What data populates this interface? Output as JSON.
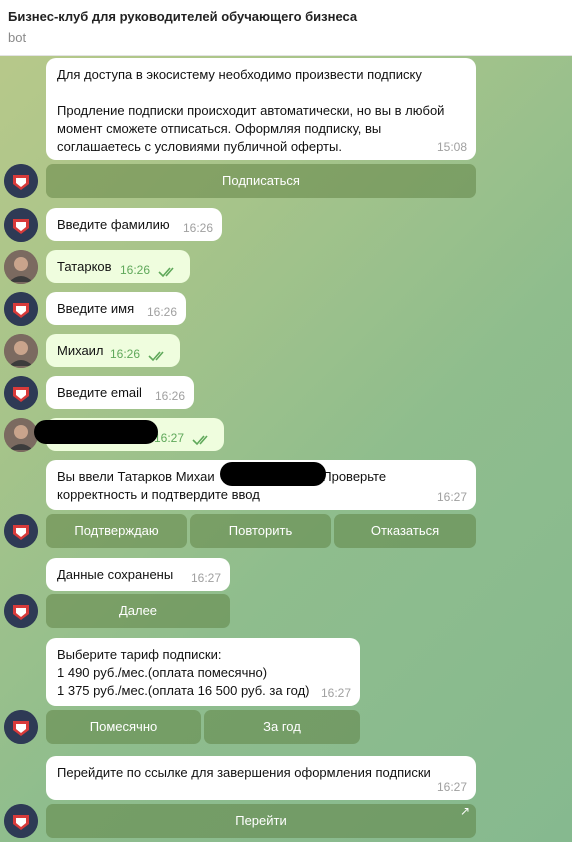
{
  "header": {
    "title": "Бизнес-клуб для руководителей обучающего бизнеса",
    "subtitle": "bot"
  },
  "messages": {
    "m1": {
      "text": "Для доступа в экосистему необходимо произвести подписку\n\nПродление подписки происходит автоматически, но вы в любой момент сможете отписаться. Оформляя подписку, вы соглашаетесь с условиями публичной оферты.",
      "time": "15:08"
    },
    "m2": {
      "text": "Введите фамилию",
      "time": "16:26"
    },
    "m3": {
      "text": "Татарков",
      "time": "16:26"
    },
    "m4": {
      "text": "Введите имя",
      "time": "16:26"
    },
    "m5": {
      "text": "Михаил",
      "time": "16:26"
    },
    "m6": {
      "text": "Введите email",
      "time": "16:26"
    },
    "m7": {
      "text": "",
      "time": "16:27"
    },
    "m8": {
      "line1a": "Вы ввели Татарков Михаи",
      "line1b": " Проверьте",
      "line2": "корректность и подтвердите ввод",
      "time": "16:27"
    },
    "m9": {
      "text": "Данные сохранены",
      "time": "16:27"
    },
    "m10": {
      "text": "Выберите тариф подписки:\n1 490 руб./мес.(оплата помесячно)\n1 375 руб./мес.(оплата 16 500 руб. за год)",
      "time": "16:27"
    },
    "m11": {
      "text": "Перейдите по ссылке для завершения оформления подписки",
      "time": "16:27"
    }
  },
  "buttons": {
    "subscribe": "Подписаться",
    "confirm": "Подтверждаю",
    "repeat": "Повторить",
    "decline": "Отказаться",
    "next": "Далее",
    "monthly": "Помесячно",
    "yearly": "За год",
    "go": "Перейти",
    "go_arrow": "↗"
  },
  "icons": {
    "bot_avatar": "bot-logo-avatar",
    "user_avatar": "user-photo-avatar",
    "read_ticks": "double-check-icon"
  },
  "colors": {
    "incoming_bubble": "#ffffff",
    "outgoing_bubble": "#effdde",
    "read_tick": "#5fa85a"
  }
}
